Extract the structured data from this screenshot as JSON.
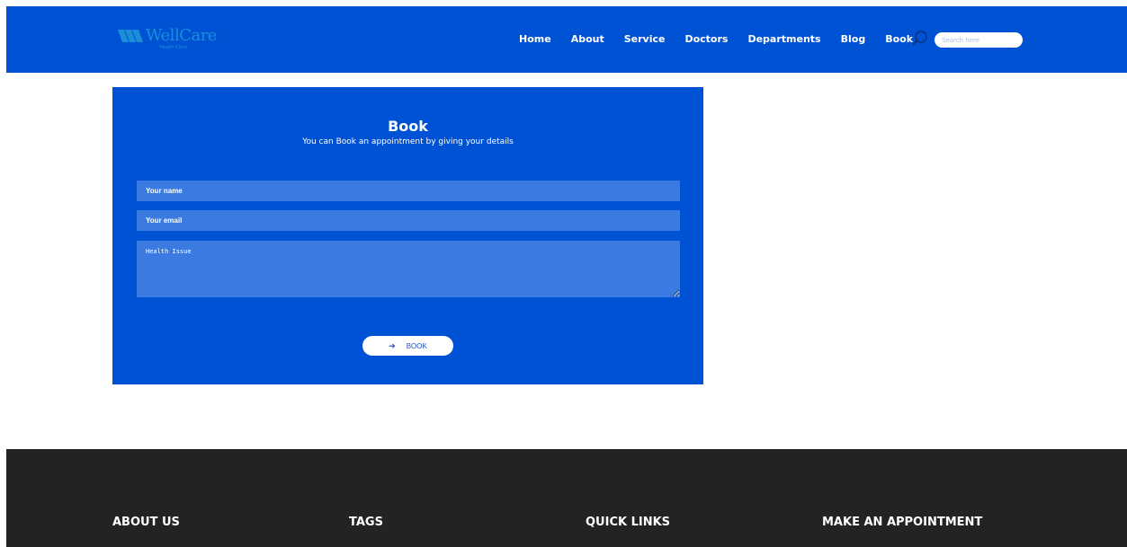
{
  "header": {
    "logo_text": "WellCare",
    "logo_subtext": "Health Clinic",
    "nav": [
      "Home",
      "About",
      "Service",
      "Doctors",
      "Departments",
      "Blog",
      "Book"
    ],
    "search_placeholder": "Search here"
  },
  "booking": {
    "title": "Book",
    "subtitle": "You can Book an appointment by giving your details",
    "name_placeholder": "Your name",
    "email_placeholder": "Your email",
    "issue_placeholder": "Health Issue",
    "button_label": "BOOK",
    "button_icon": "arrow-right-icon"
  },
  "footer": {
    "headings": [
      "ABOUT US",
      "TAGS",
      "QUICK LINKS",
      "MAKE AN APPOINTMENT"
    ]
  },
  "colors": {
    "primary_blue": "#0052d4",
    "field_blue": "#3b7ae0",
    "footer_dark": "#232323"
  }
}
